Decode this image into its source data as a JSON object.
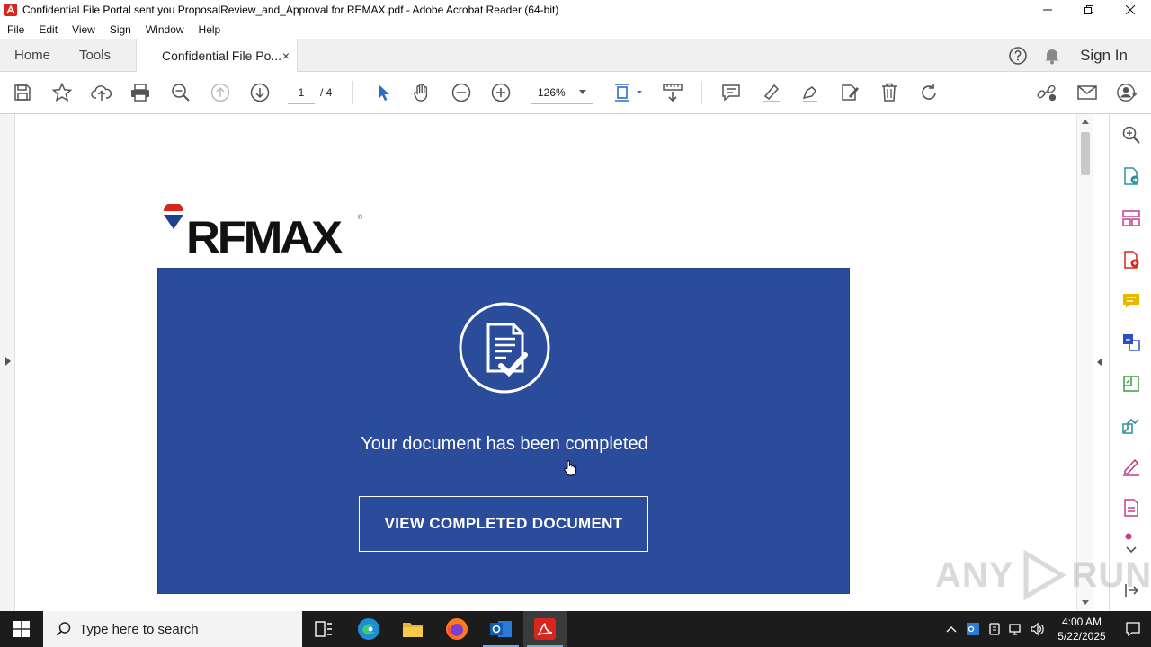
{
  "window": {
    "title": "Confidential File Portal sent you ProposalReview_and_Approval for REMAX.pdf - Adobe Acrobat Reader (64-bit)",
    "minimize": "—",
    "restore": "❐",
    "close": "✕"
  },
  "menu": [
    "File",
    "Edit",
    "View",
    "Sign",
    "Window",
    "Help"
  ],
  "tabs": {
    "home": "Home",
    "tools": "Tools",
    "doc": "Confidential File Po...",
    "close": "×",
    "sign_in": "Sign In"
  },
  "toolbar": {
    "page_current": "1",
    "page_total": "/ 4",
    "zoom": "126%"
  },
  "document": {
    "logo_text": "RFMAX",
    "logo_tm": "®",
    "message": "Your document has been completed",
    "button": "VIEW COMPLETED DOCUMENT"
  },
  "watermark": {
    "left": "ANY",
    "right": "RUN"
  },
  "taskbar": {
    "search_placeholder": "Type here to search",
    "time": "4:00 AM",
    "date": "5/22/2025"
  },
  "colors": {
    "banner": "#2b4c9b",
    "acrobat_red": "#d9261c",
    "toolbar_icon": "#555555",
    "taskbar": "#1c1c1c"
  }
}
